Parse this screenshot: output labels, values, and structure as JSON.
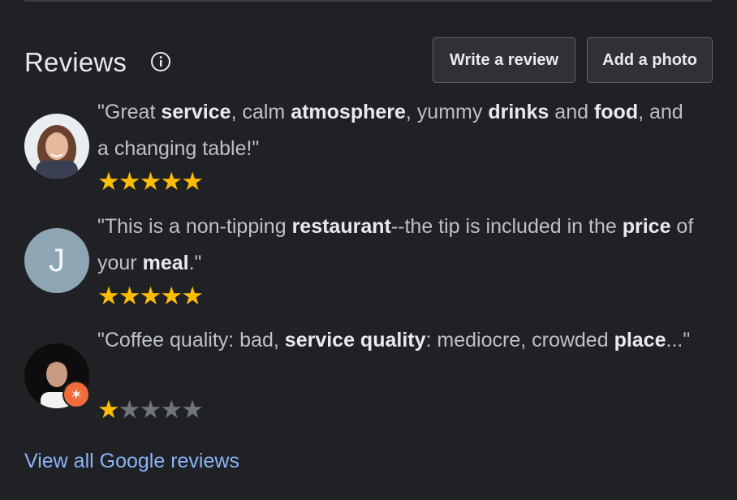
{
  "header": {
    "title": "Reviews",
    "info_icon": "info-icon",
    "write_review_label": "Write a review",
    "add_photo_label": "Add a photo"
  },
  "reviews": [
    {
      "avatar": "photo-woman",
      "parts": [
        {
          "t": "\"Great ",
          "b": false
        },
        {
          "t": "service",
          "b": true
        },
        {
          "t": ", calm ",
          "b": false
        },
        {
          "t": "atmosphere",
          "b": true
        },
        {
          "t": ", yummy ",
          "b": false
        },
        {
          "t": "drinks",
          "b": true
        },
        {
          "t": " and ",
          "b": false
        },
        {
          "t": "food",
          "b": true
        },
        {
          "t": ", and a changing table!\"",
          "b": false
        }
      ],
      "rating": 5
    },
    {
      "avatar_letter": "J",
      "parts": [
        {
          "t": "\"This is a non-tipping ",
          "b": false
        },
        {
          "t": "restaurant",
          "b": true
        },
        {
          "t": "--the tip is included in the ",
          "b": false
        },
        {
          "t": "price",
          "b": true
        },
        {
          "t": " of your ",
          "b": false
        },
        {
          "t": "meal",
          "b": true
        },
        {
          "t": ".\"",
          "b": false
        }
      ],
      "rating": 5
    },
    {
      "avatar": "photo-man",
      "badge": "local-guide-badge-icon",
      "parts": [
        {
          "t": "\"Coffee quality: bad, ",
          "b": false
        },
        {
          "t": "service quality",
          "b": true
        },
        {
          "t": ": mediocre, crowded ",
          "b": false
        },
        {
          "t": "place",
          "b": true
        },
        {
          "t": "...\"",
          "b": false
        }
      ],
      "rating": 1
    }
  ],
  "footer": {
    "view_all_label": "View all Google reviews"
  },
  "colors": {
    "background": "#202124",
    "star_filled": "#fbbc04",
    "star_empty": "#70757a",
    "link": "#8ab4f8"
  }
}
